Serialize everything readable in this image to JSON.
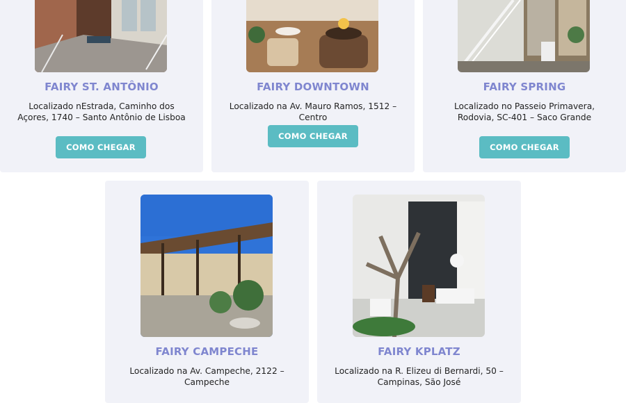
{
  "locations": [
    {
      "title": "FAIRY ST. ANTÔNIO",
      "address": "Localizado nEstrada, Caminho dos Açores, 1740 – Santo Antônio de Lisboa",
      "button_label": "COMO CHEGAR"
    },
    {
      "title": "FAIRY DOWNTOWN",
      "address": "Localizado na Av. Mauro Ramos, 1512 – Centro",
      "button_label": "COMO CHEGAR"
    },
    {
      "title": "FAIRY SPRING",
      "address": "Localizado no Passeio Primavera, Rodovia, SC-401 – Saco Grande",
      "button_label": "COMO CHEGAR"
    },
    {
      "title": "FAIRY CAMPECHE",
      "address": "Localizado na Av. Campeche, 2122 – Campeche"
    },
    {
      "title": "FAIRY KPLATZ",
      "address": "Localizado na R. Elizeu di Bernardi, 50 – Campinas, São José"
    }
  ]
}
